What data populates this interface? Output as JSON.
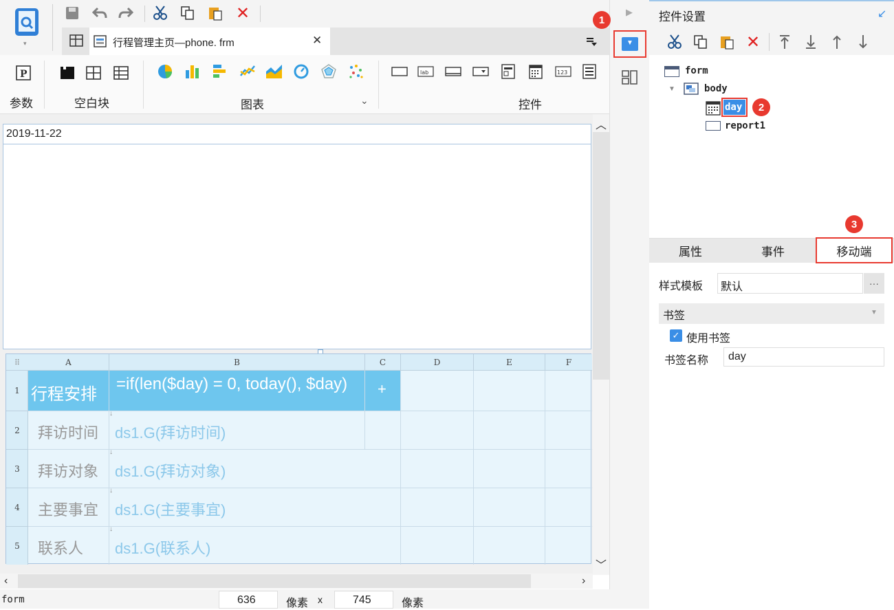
{
  "tab": {
    "title": "行程管理主页—phone. frm"
  },
  "ribbon": {
    "group_param": "参数",
    "group_blank": "空白块",
    "group_chart": "图表",
    "group_widget": "控件"
  },
  "canvas": {
    "date_value": "2019-11-22",
    "columns": [
      "A",
      "B",
      "C",
      "D",
      "E",
      "F"
    ],
    "rows": [
      "1",
      "2",
      "3",
      "4",
      "5"
    ],
    "cells": {
      "r1a": "行程安排",
      "r1b": "=if(len($day) = 0, today(), $day)",
      "r1c": "+",
      "r2a": "拜访时间",
      "r2b": "ds1.G(拜访时间)",
      "r3a": "拜访对象",
      "r3b": "ds1.G(拜访对象)",
      "r4a": "主要事宜",
      "r4b": "ds1.G(主要事宜)",
      "r5a": "联系人",
      "r5b": "ds1.G(联系人)"
    }
  },
  "status_bar": {
    "selection": "form",
    "width": "636",
    "unit1": "像素",
    "times": "x",
    "height": "745",
    "unit2": "像素"
  },
  "right_panel": {
    "title": "控件设置",
    "tree": {
      "form": "form",
      "body": "body",
      "day": "day",
      "report": "report1"
    },
    "tabs": {
      "attr": "属性",
      "event": "事件",
      "mobile": "移动端"
    },
    "style_template_label": "样式模板",
    "style_template_value": "默认",
    "more": "···",
    "bookmark_section": "书签",
    "use_bookmark_label": "使用书签",
    "use_bookmark_checked": true,
    "bookmark_name_label": "书签名称",
    "bookmark_name_value": "day"
  },
  "badges": [
    "1",
    "2",
    "3"
  ],
  "colors": {
    "accent": "#3a8ee6",
    "badge": "#e8392f",
    "header_cell": "#6ec6ee",
    "grid_bg": "#e8f5fc"
  }
}
